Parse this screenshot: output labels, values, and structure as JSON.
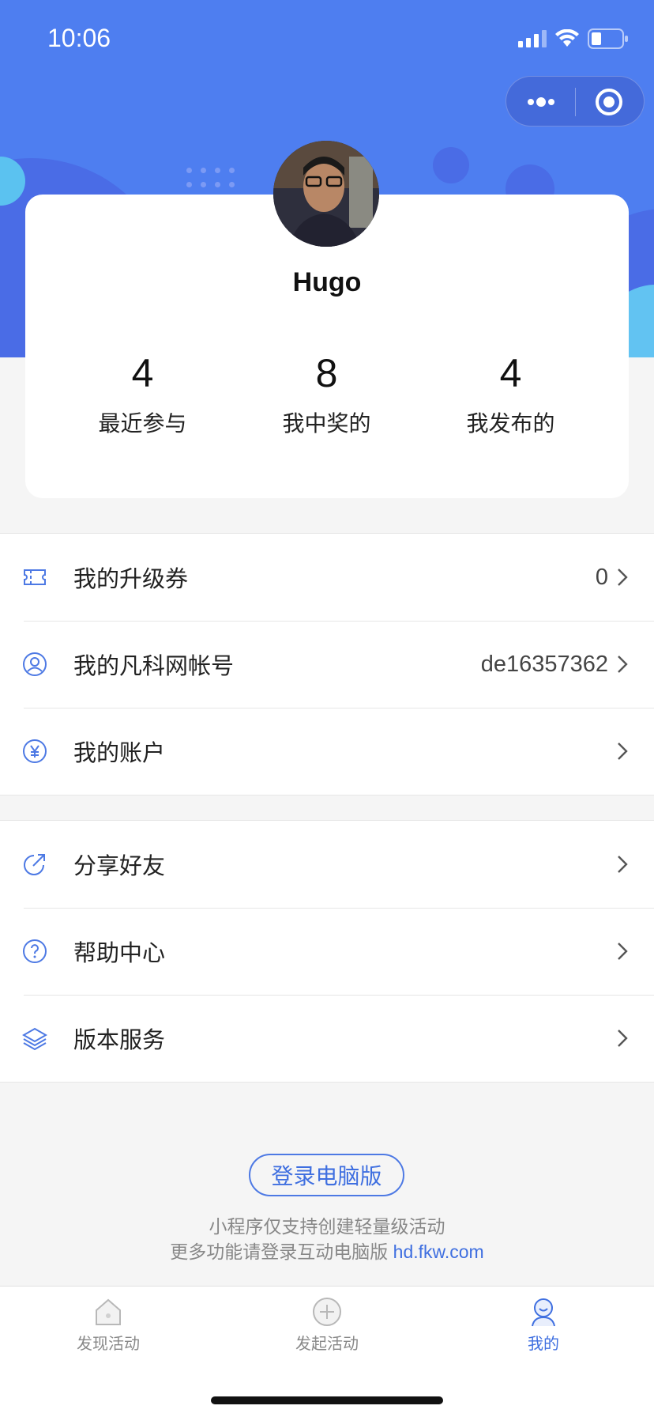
{
  "status_bar": {
    "time": "10:06"
  },
  "profile": {
    "username": "Hugo",
    "stats": [
      {
        "value": "4",
        "label": "最近参与"
      },
      {
        "value": "8",
        "label": "我中奖的"
      },
      {
        "value": "4",
        "label": "我发布的"
      }
    ]
  },
  "menu_group1": {
    "items": [
      {
        "label": "我的升级券",
        "value": "0"
      },
      {
        "label": "我的凡科网帐号",
        "value": "de16357362"
      },
      {
        "label": "我的账户",
        "value": ""
      }
    ]
  },
  "menu_group2": {
    "items": [
      {
        "label": "分享好友"
      },
      {
        "label": "帮助中心"
      },
      {
        "label": "版本服务"
      }
    ]
  },
  "footer": {
    "login_button": "登录电脑版",
    "note_line1": "小程序仅支持创建轻量级活动",
    "note_line2": "更多功能请登录互动电脑版 ",
    "note_link": "hd.fkw.com"
  },
  "tabbar": {
    "tabs": [
      {
        "label": "发现活动",
        "icon": "home-icon"
      },
      {
        "label": "发起活动",
        "icon": "plus-circle-icon"
      },
      {
        "label": "我的",
        "icon": "user-icon"
      }
    ]
  },
  "colors": {
    "brand": "#4e7ef0",
    "accent": "#3f6fe0"
  }
}
